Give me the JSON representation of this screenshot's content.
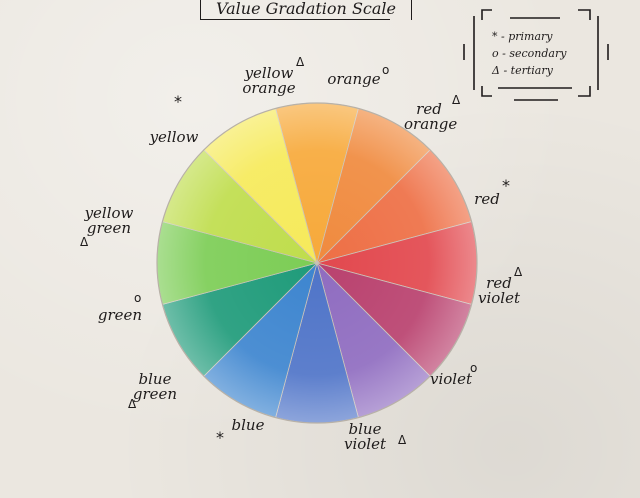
{
  "title": "Value Gradation Scale",
  "legend": {
    "primary": "* - primary",
    "secondary": "o - secondary",
    "tertiary": "Δ - tertiary"
  },
  "symbols": {
    "primary": "*",
    "secondary": "o",
    "tertiary": "Δ"
  },
  "labels": {
    "yellow_orange": "yellow\norange",
    "orange": "orange",
    "red_orange": "red\norange",
    "red": "red",
    "red_violet": "red\nviolet",
    "violet": "violet",
    "blue_violet": "blue\nviolet",
    "blue": "blue",
    "blue_green": "blue\ngreen",
    "green": "green",
    "yellow_green": "yellow\ngreen",
    "yellow": "yellow"
  },
  "colors": {
    "paper": "#ebe7e0",
    "ink": "#1f1c1c",
    "yellow_orange": "#f7a93a",
    "orange": "#f08a3e",
    "red_orange": "#ee6f45",
    "red": "#e2484e",
    "red_violet": "#b9416e",
    "violet": "#8f6cc0",
    "blue_violet": "#4f74c8",
    "blue": "#3d85cf",
    "blue_green": "#1f9b7a",
    "green": "#7ccd55",
    "yellow_green": "#bfdd4c",
    "yellow": "#f6ea5a"
  }
}
